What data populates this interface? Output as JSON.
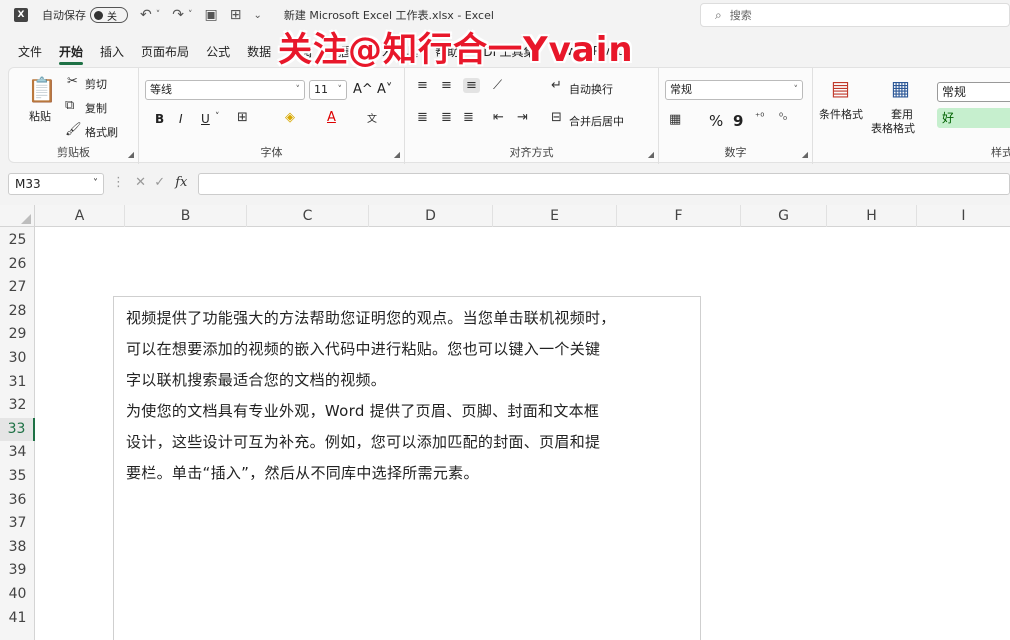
{
  "titlebar": {
    "autosave_label": "自动保存",
    "toggle_label": "关",
    "filename": "新建 Microsoft Excel 工作表.xlsx  -  Excel",
    "search_placeholder": "搜索"
  },
  "overlay_text": "关注@知行合一Yvain",
  "tabs": [
    {
      "label": "文件"
    },
    {
      "label": "开始"
    },
    {
      "label": "插入"
    },
    {
      "label": "页面布局"
    },
    {
      "label": "公式"
    },
    {
      "label": "数据"
    },
    {
      "label": "审阅"
    },
    {
      "label": "视图"
    },
    {
      "label": "开发工具"
    },
    {
      "label": "帮助"
    },
    {
      "label": "PDF工具集"
    },
    {
      "label": "Power Pivot"
    }
  ],
  "ribbon": {
    "clipboard": {
      "paste": "粘贴",
      "cut": "剪切",
      "copy": "复制",
      "format_painter": "格式刷",
      "label": "剪贴板"
    },
    "font": {
      "font_name": "等线",
      "font_size": "11",
      "grow": "A^",
      "shrink": "A˅",
      "bold": "B",
      "italic": "I",
      "underline": "U",
      "label": "字体"
    },
    "alignment": {
      "wrap_text": "自动换行",
      "merge_center": "合并后居中",
      "label": "对齐方式"
    },
    "number": {
      "format": "常规",
      "percent": "%",
      "comma": "9",
      "label": "数字"
    },
    "styles": {
      "conditional": "条件格式",
      "table_format_1": "套用",
      "table_format_2": "表格格式",
      "style_normal": "常规",
      "style_good": "好",
      "label": "样式"
    }
  },
  "formula_bar": {
    "name_box": "M33",
    "formula": ""
  },
  "columns": [
    "A",
    "B",
    "C",
    "D",
    "E",
    "F",
    "G",
    "H",
    "I"
  ],
  "rows": [
    "25",
    "26",
    "27",
    "28",
    "29",
    "30",
    "31",
    "32",
    "33",
    "34",
    "35",
    "36",
    "37",
    "38",
    "39",
    "40",
    "41"
  ],
  "active_row": "33",
  "textbox_lines": [
    "视频提供了功能强大的方法帮助您证明您的观点。当您单击联机视频时，",
    "可以在想要添加的视频的嵌入代码中进行粘贴。您也可以键入一个关键",
    "字以联机搜索最适合您的文档的视频。",
    "为使您的文档具有专业外观，Word 提供了页眉、页脚、封面和文本框",
    "设计，这些设计可互为补充。例如，您可以添加匹配的封面、页眉和提",
    "要栏。单击“插入”，然后从不同库中选择所需元素。"
  ],
  "colors": {
    "accent": "#1e7145",
    "overlay": "#e8172a",
    "style_good_bg": "#c6efce",
    "style_good_text": "#006100"
  }
}
